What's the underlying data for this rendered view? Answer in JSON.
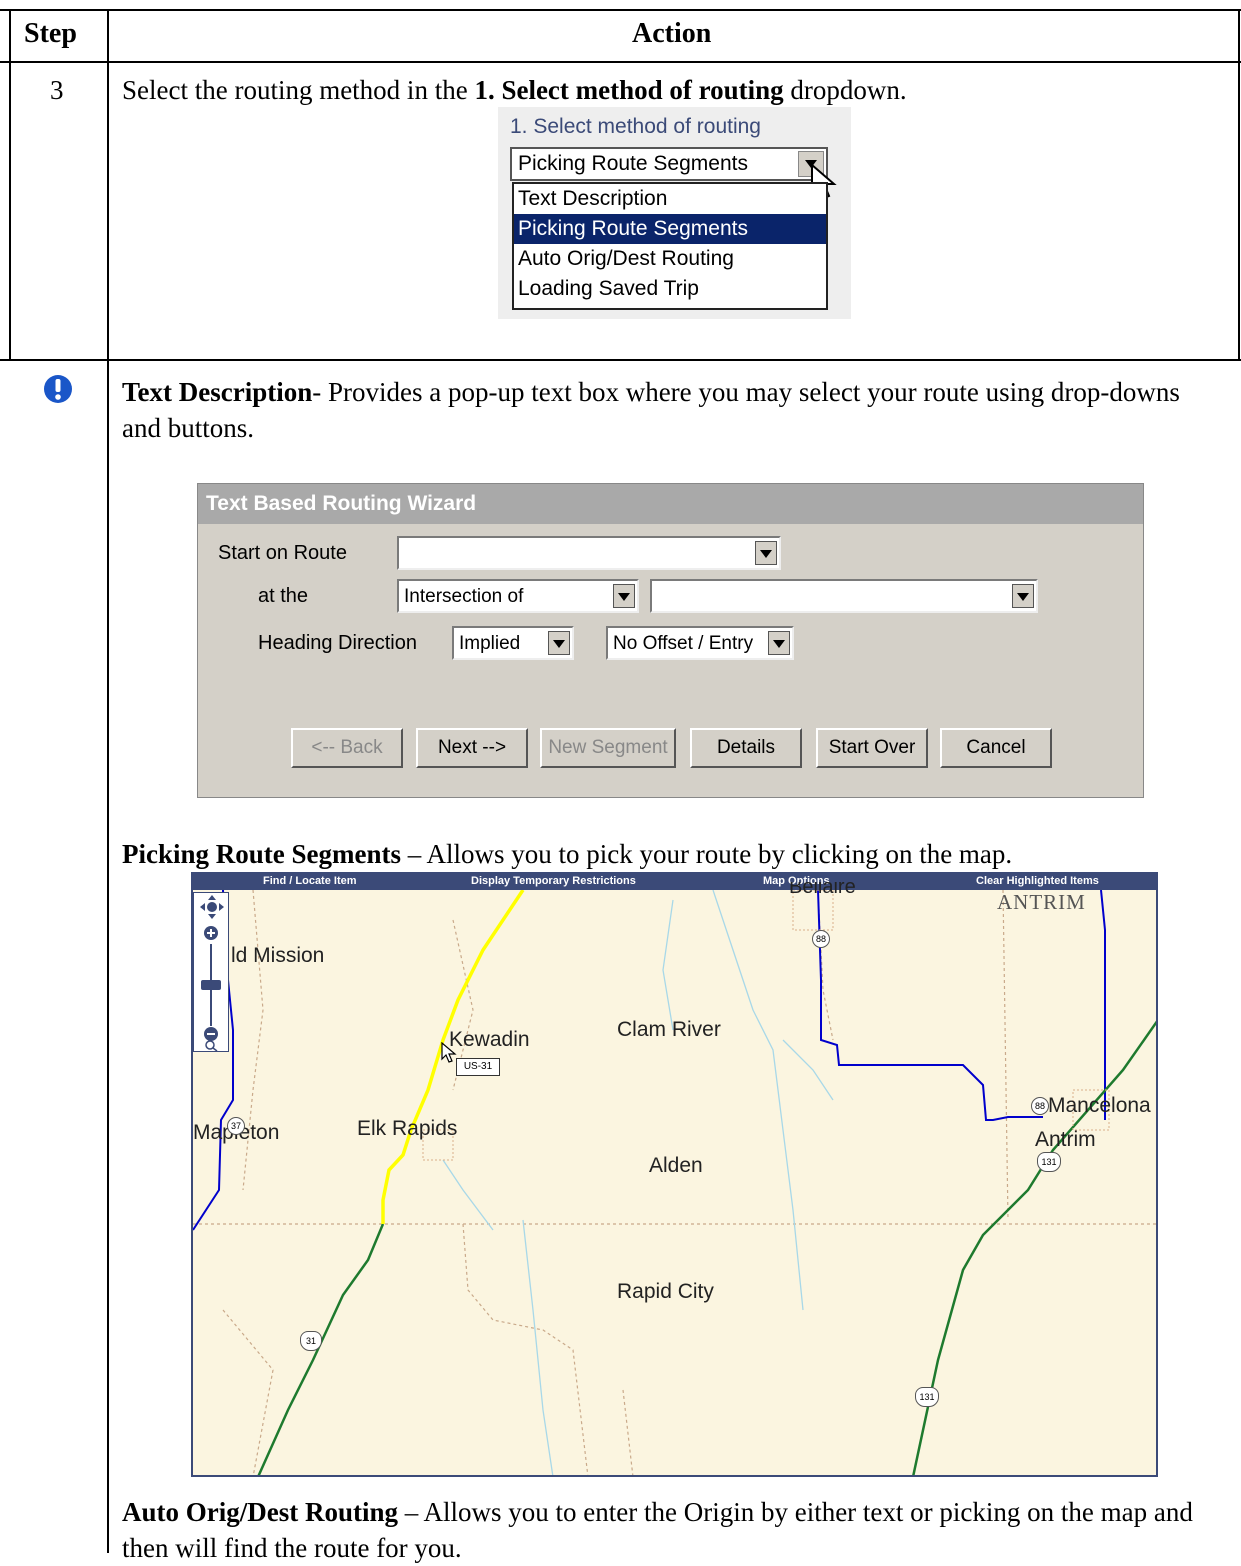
{
  "table": {
    "header_step": "Step",
    "header_action": "Action",
    "step_number": "3",
    "instruction_pre": "Select the routing method in the ",
    "instruction_bold": "1. Select method of routing",
    "instruction_post": " dropdown.",
    "note_icon": "exclamation-icon"
  },
  "dropdown": {
    "label": "1. Select method of routing",
    "current_value": "Picking Route Segments",
    "options": [
      "Text Description",
      "Picking Route Segments",
      "Auto Orig/Dest Routing",
      "Loading Saved Trip"
    ],
    "selected_index": 1
  },
  "text_description": {
    "term": "Text Description",
    "desc": "- Provides a pop-up text box where you may select your route using drop-downs and buttons."
  },
  "wizard": {
    "title": "Text Based Routing Wizard",
    "start_on_route_label": "Start on Route",
    "start_on_route_value": "",
    "at_the_label": "at the",
    "at_the_value": "Intersection of",
    "intersection_value": "",
    "heading_label": "Heading Direction",
    "heading_value": "Implied",
    "offset_value": "No Offset / Entry",
    "buttons": {
      "back": "<-- Back",
      "next": "Next -->",
      "new_segment": "New Segment",
      "details": "Details",
      "start_over": "Start Over",
      "cancel": "Cancel"
    }
  },
  "picking": {
    "term": "Picking Route Segments",
    "desc": " – Allows you to pick your route by clicking on the map."
  },
  "map": {
    "toolbar": [
      "Find / Locate Item",
      "Display Temporary Restrictions",
      "Map Options",
      "Clear Highlighted Items"
    ],
    "places": {
      "old_mission": "ld Mission",
      "clam_river": "Clam River",
      "kewadin": "Kewadin",
      "mapleton": "Mapleton",
      "elk_rapids": "Elk Rapids",
      "alden": "Alden",
      "rapid_city": "Rapid City",
      "mancelona": "Mancelona",
      "antrim_town": "Antrim",
      "antrim_county": "ANTRIM",
      "bellaire": "Bellaire"
    },
    "tooltip": "US-31",
    "shields": {
      "s88a": "88",
      "s88b": "88",
      "s37": "37",
      "s131a": "131",
      "s131b": "131",
      "s31": "31"
    },
    "colors": {
      "selected_route": "#ffff00",
      "us_route": "#1e7a2e",
      "state_route": "#0000cc",
      "water": "#a8d8e8"
    }
  },
  "auto": {
    "term": "Auto Orig/Dest Routing",
    "desc": " – Allows you to enter the Origin by either text or picking on the map and then will find the route for you."
  }
}
